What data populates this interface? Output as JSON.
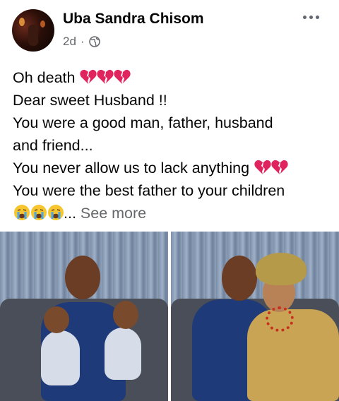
{
  "post": {
    "author_name": "Uba Sandra Chisom",
    "time_ago": "2d",
    "separator": "·",
    "audience_icon": "globe-icon",
    "more_icon": "more-options-icon"
  },
  "body": {
    "line1": "Oh death",
    "line2": "Dear sweet Husband !!",
    "line3": "You were a good man, father, husband",
    "line4": "and friend...",
    "line5": "You never allow us to lack anything",
    "line6": "You were the best father to your children",
    "ellipsis": "...",
    "see_more": "See more",
    "emoji_icons": [
      "broken-heart-icon",
      "crying-face-icon"
    ]
  },
  "photos": {
    "count": 2,
    "items": [
      "photo-man-with-twin-babies",
      "photo-man-with-woman"
    ]
  },
  "colors": {
    "text": "#050505",
    "secondary_text": "#65676b",
    "broken_heart": "#e0245e",
    "crying_face": "#f7c52d"
  }
}
